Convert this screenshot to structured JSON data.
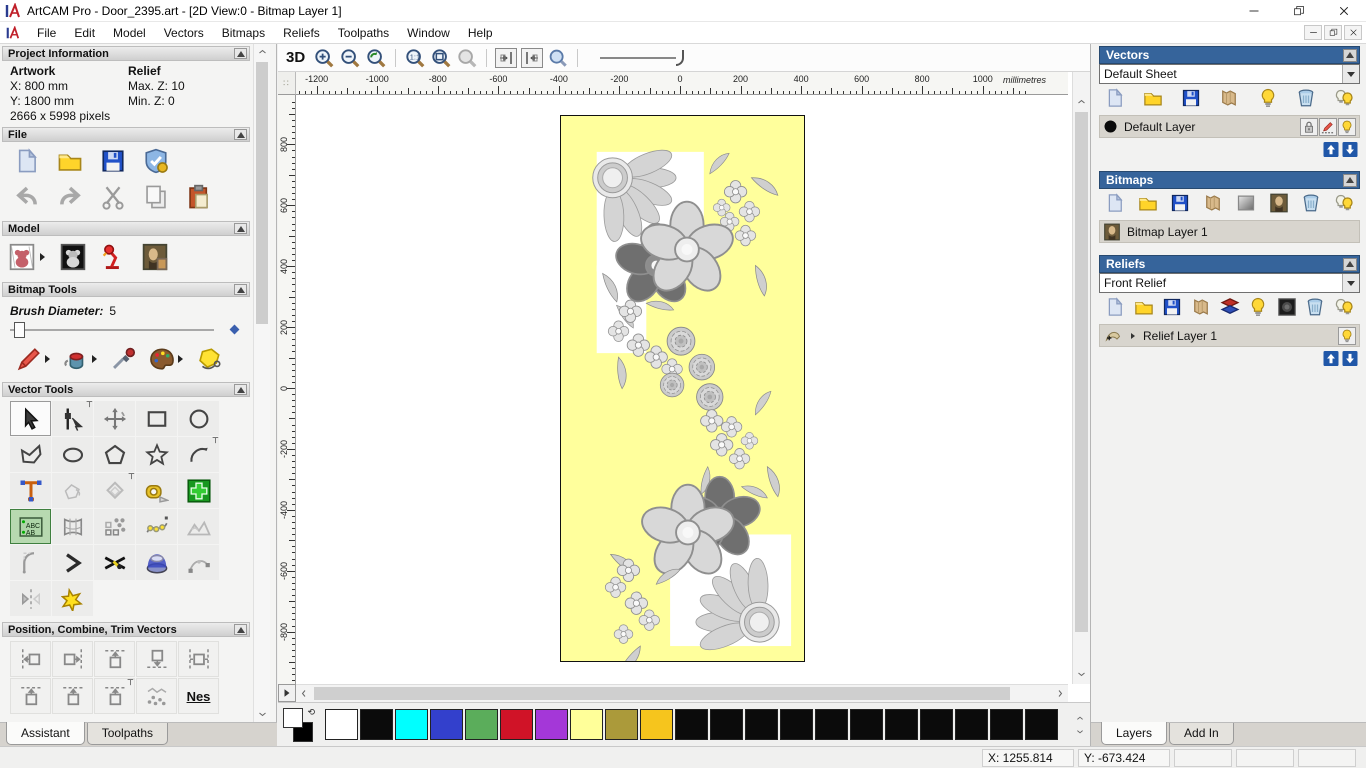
{
  "window": {
    "title": "ArtCAM Pro - Door_2395.art - [2D View:0 - Bitmap Layer 1]",
    "menu_items": [
      "File",
      "Edit",
      "Model",
      "Vectors",
      "Bitmaps",
      "Reliefs",
      "Toolpaths",
      "Window",
      "Help"
    ]
  },
  "assistant_panel": {
    "project_information": {
      "title": "Project Information",
      "artwork_heading": "Artwork",
      "relief_heading": "Relief",
      "artwork_x": "X: 800 mm",
      "artwork_y": "Y: 1800 mm",
      "relief_max_z": "Max. Z: 10",
      "relief_min_z": "Min. Z: 0",
      "artwork_pixels": "2666 x 5998 pixels"
    },
    "file_section_title": "File",
    "model_section_title": "Model",
    "bitmap_tools": {
      "title": "Bitmap Tools",
      "brush_diameter_label": "Brush Diameter:",
      "brush_diameter_value": "5"
    },
    "vector_tools_title": "Vector Tools",
    "position_section_title": "Position, Combine, Trim Vectors",
    "nesting_glyph": "Nes",
    "tabs": [
      {
        "label": "Assistant",
        "active": true
      },
      {
        "label": "Toolpaths",
        "active": false
      }
    ]
  },
  "view": {
    "toolbar_3d_label": "3D",
    "ruler_units": "millimetres",
    "h_ruler_labels": [
      -1200,
      -1000,
      -800,
      -600,
      -400,
      -200,
      0,
      200,
      400,
      600,
      800,
      1000
    ],
    "v_ruler_labels": [
      800,
      600,
      400,
      200,
      0,
      -200,
      -400,
      -600,
      -800
    ],
    "artwork_background": "#FFFF9C"
  },
  "color_palette": {
    "primary": "#FFFFFF",
    "secondary": "#000000",
    "swatches": [
      "#FFFFFF",
      "#0B0B0B",
      "#00FFFF",
      "#3340CC",
      "#5BAD5B",
      "#D01327",
      "#A437D8",
      "#FFFF99",
      "#AB9A3A",
      "#F6C51D",
      "#0B0B0B",
      "#0B0B0B",
      "#0B0B0B",
      "#0B0B0B",
      "#0B0B0B",
      "#0B0B0B",
      "#0B0B0B",
      "#0B0B0B",
      "#0B0B0B",
      "#0B0B0B",
      "#0B0B0B"
    ]
  },
  "layers_panel": {
    "vectors": {
      "title": "Vectors",
      "sheet_selector_value": "Default Sheet",
      "layer_name": "Default Layer"
    },
    "bitmaps": {
      "title": "Bitmaps",
      "layer_name": "Bitmap Layer 1"
    },
    "reliefs": {
      "title": "Reliefs",
      "relief_selector_value": "Front Relief",
      "layer_name": "Relief Layer 1"
    },
    "tabs": [
      {
        "label": "Layers",
        "active": true
      },
      {
        "label": "Add In",
        "active": false
      }
    ]
  },
  "status_bar": {
    "x_coordinate": "X: 1255.814",
    "y_coordinate": "Y: -673.424"
  }
}
